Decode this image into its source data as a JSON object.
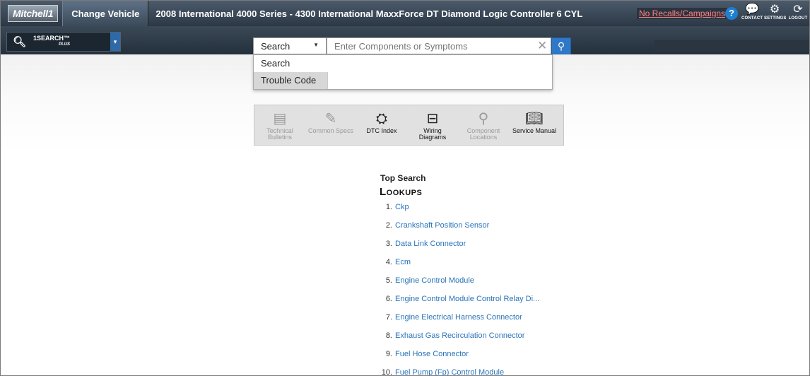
{
  "header": {
    "logo": "Mitchell1",
    "change_vehicle": "Change Vehicle",
    "vehicle_title": "2008 International 4000 Series - 4300 International MaxxForce DT Diamond Logic Controller 6 CYL",
    "recalls": "No Recalls/Campaigns",
    "help": "?",
    "contact_label": "CONTACT",
    "settings_label": "SETTINGS",
    "logout_label": "LOGOUT"
  },
  "searchbar": {
    "product_name": "1SEARCH™",
    "product_sub": "PLUS",
    "type_selected": "Search",
    "input_placeholder": "Enter Components or Symptoms"
  },
  "dropdown": {
    "options": [
      "Search",
      "Trouble Code"
    ],
    "highlighted": "Trouble Code"
  },
  "tools": [
    {
      "line1": "Technical",
      "line2": "Bulletins",
      "icon": "tsb-icon",
      "enabled": false
    },
    {
      "line1": "Common Specs",
      "line2": "",
      "icon": "specs-icon",
      "enabled": false
    },
    {
      "line1": "DTC Index",
      "line2": "",
      "icon": "engine-icon",
      "enabled": true
    },
    {
      "line1": "Wiring",
      "line2": "Diagrams",
      "icon": "wiring-icon",
      "enabled": true
    },
    {
      "line1": "Component",
      "line2": "Locations",
      "icon": "location-icon",
      "enabled": false
    },
    {
      "line1": "Service Manual",
      "line2": "",
      "icon": "book-icon",
      "enabled": true
    }
  ],
  "lookups": {
    "top_search": "Top Search",
    "title": "Lookups",
    "items": [
      {
        "num": "1.",
        "label": "Ckp"
      },
      {
        "num": "2.",
        "label": "Crankshaft Position Sensor"
      },
      {
        "num": "3.",
        "label": "Data Link Connector"
      },
      {
        "num": "4.",
        "label": "Ecm"
      },
      {
        "num": "5.",
        "label": "Engine Control Module"
      },
      {
        "num": "6.",
        "label": "Engine Control Module Control Relay Di..."
      },
      {
        "num": "7.",
        "label": "Engine Electrical Harness Connector"
      },
      {
        "num": "8.",
        "label": "Exhaust Gas Recirculation Connector"
      },
      {
        "num": "9.",
        "label": "Fuel Hose Connector"
      },
      {
        "num": "10.",
        "label": "Fuel Pump (Fp) Control Module"
      }
    ]
  }
}
